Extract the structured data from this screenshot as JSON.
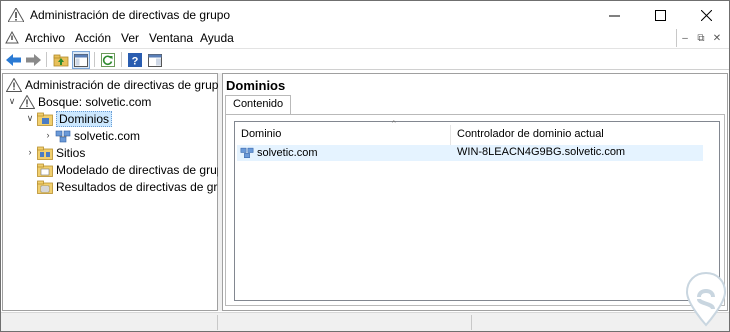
{
  "window": {
    "title": "Administración de directivas de grupo"
  },
  "menu": {
    "items": [
      "Archivo",
      "Acción",
      "Ver",
      "Ventana",
      "Ayuda"
    ]
  },
  "toolbar": {
    "buttons": [
      "back-icon",
      "forward-icon",
      "up-folder-icon",
      "show-hide-tree-icon",
      "refresh-icon",
      "help-icon",
      "properties-icon"
    ]
  },
  "tree": {
    "root": "Administración de directivas de grupo",
    "forest": "Bosque: solvetic.com",
    "domains": "Dominios",
    "domain": "solvetic.com",
    "sites": "Sitios",
    "modeling": "Modelado de directivas de grupo",
    "results": "Resultados de directivas de grupo"
  },
  "main": {
    "title": "Dominios",
    "tab": "Contenido",
    "columns": [
      "Dominio",
      "Controlador de dominio actual"
    ],
    "rows": [
      {
        "domain": "solvetic.com",
        "controller": "WIN-8LEACN4G9BG.solvetic.com"
      }
    ]
  },
  "colors": {
    "selection": "#cce8ff",
    "row_highlight": "#e5f3ff",
    "accent": "#1e73d6"
  }
}
